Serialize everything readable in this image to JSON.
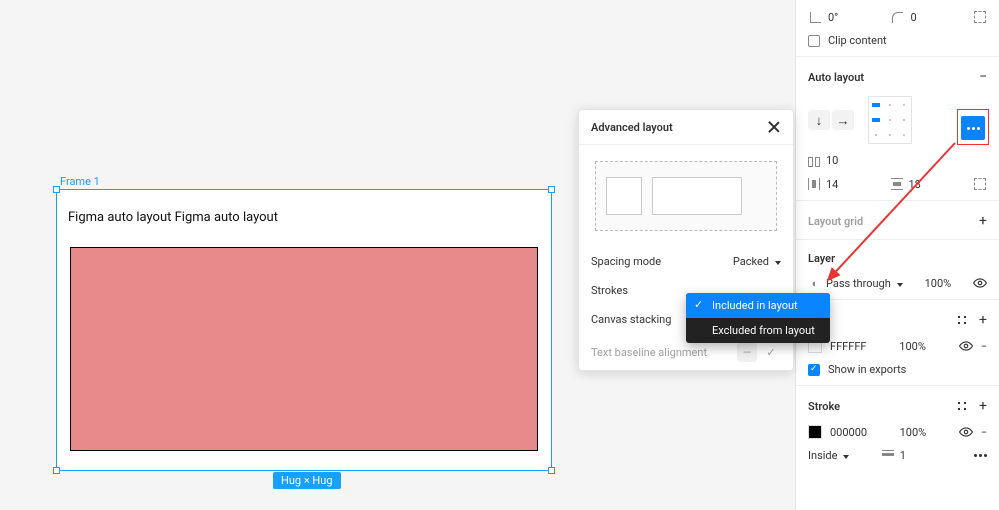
{
  "canvas": {
    "frame_label": "Frame 1",
    "text": "Figma auto layout Figma auto layout",
    "hug_badge": "Hug × Hug"
  },
  "advanced_layout": {
    "title": "Advanced layout",
    "spacing_mode": {
      "label": "Spacing mode",
      "value": "Packed"
    },
    "strokes": {
      "label": "Strokes"
    },
    "canvas_stacking": {
      "label": "Canvas stacking"
    },
    "text_baseline": {
      "label": "Text baseline alignment"
    }
  },
  "strokes_dropdown": {
    "included": "Included in layout",
    "excluded": "Excluded from layout"
  },
  "inspector": {
    "transform": {
      "rotation": "0°",
      "corner": "0"
    },
    "clip_content": "Clip content",
    "auto_layout": {
      "title": "Auto layout",
      "gap": "10",
      "padding_h": "14",
      "padding_v": "18"
    },
    "layout_grid": {
      "title": "Layout grid"
    },
    "layer": {
      "title": "Layer",
      "blend_label": "Pass through",
      "opacity": "100%"
    },
    "fill": {
      "hex": "FFFFFF",
      "opacity": "100%",
      "show_in_exports": "Show in exports"
    },
    "stroke": {
      "title": "Stroke",
      "hex": "000000",
      "opacity": "100%",
      "position": "Inside",
      "width": "1"
    }
  }
}
